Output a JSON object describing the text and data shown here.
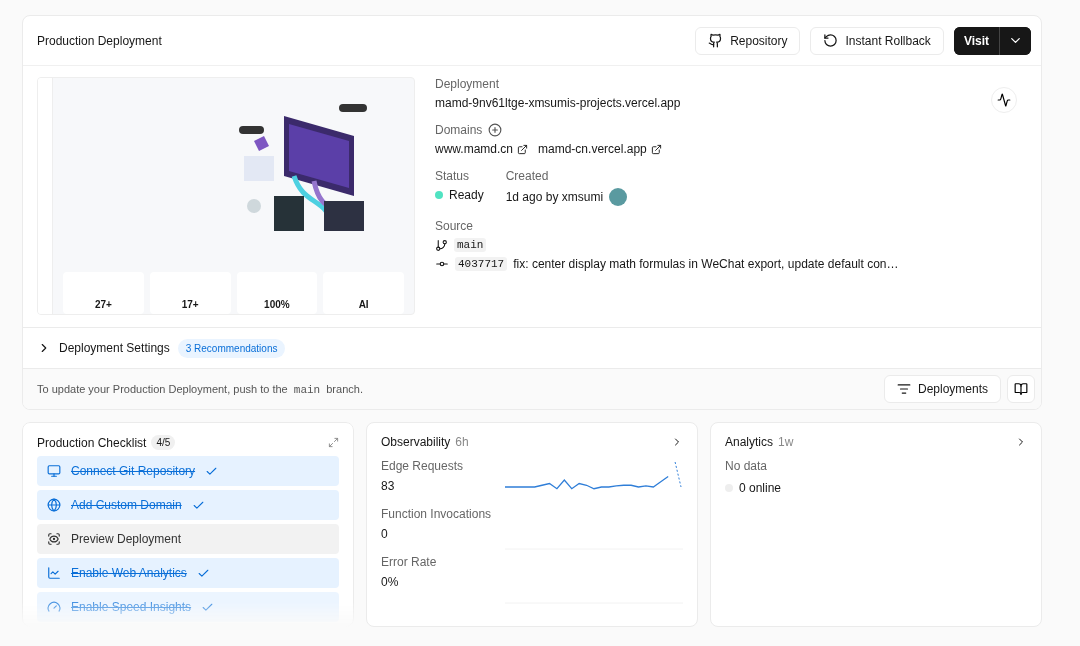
{
  "header": {
    "title": "Production Deployment",
    "buttons": [
      {
        "kind": "github",
        "label": "Repository"
      },
      {
        "kind": "rollback",
        "label": "Instant Rollback"
      }
    ],
    "visit": "Visit"
  },
  "preview": {
    "stats": [
      "27+",
      "17+",
      "100%",
      "AI"
    ]
  },
  "details": {
    "deployment_label": "Deployment",
    "deployment_url": "mamd-9nv61ltge-xmsumis-projects.vercel.app",
    "domains_label": "Domains",
    "domains": [
      "www.mamd.cn",
      "mamd-cn.vercel.app"
    ],
    "status_label": "Status",
    "status": "Ready",
    "created_label": "Created",
    "created": "1d ago by xmsumi",
    "source_label": "Source",
    "branch": "main",
    "commit_hash": "4037717",
    "commit_message": "fix: center display math formulas in WeChat export, update default con…"
  },
  "settings": {
    "label": "Deployment Settings",
    "expanded": false,
    "badge": "3 Recommendations"
  },
  "footer": {
    "before": "To update your Production Deployment, push to the",
    "branch": "main",
    "after": "branch.",
    "button": "Deployments"
  },
  "checklist": {
    "title": "Production Checklist",
    "count": "4/5",
    "items": [
      {
        "kind": "git",
        "label": "Connect Git Repository",
        "done": true
      },
      {
        "kind": "globe",
        "label": "Add Custom Domain",
        "done": true
      },
      {
        "kind": "preview",
        "label": "Preview Deployment",
        "done": false
      },
      {
        "kind": "analytics",
        "label": "Enable Web Analytics",
        "done": true
      },
      {
        "kind": "speed",
        "label": "Enable Speed Insights",
        "done": true
      }
    ]
  },
  "observability": {
    "title": "Observability",
    "range": "6h",
    "metrics": [
      {
        "label": "Edge Requests",
        "value": "83"
      },
      {
        "label": "Function Invocations",
        "value": "0"
      },
      {
        "label": "Error Rate",
        "value": "0%"
      }
    ]
  },
  "analytics": {
    "title": "Analytics",
    "range": "1w",
    "empty": "No data",
    "online": "0 online"
  }
}
